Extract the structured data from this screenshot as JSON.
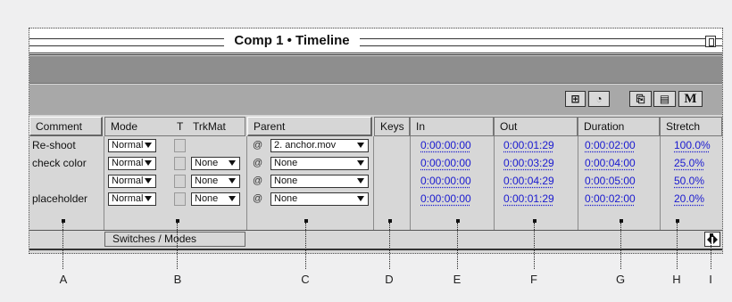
{
  "window": {
    "title": "Comp 1 • Timeline"
  },
  "toolbar": {
    "buttons": [
      "⊞",
      "◔",
      "⎘",
      "▤",
      "M"
    ]
  },
  "columns": {
    "comment": "Comment",
    "mode": "Mode",
    "t": "T",
    "trkmat": "TrkMat",
    "parent": "Parent",
    "keys": "Keys",
    "in": "In",
    "out": "Out",
    "duration": "Duration",
    "stretch": "Stretch"
  },
  "rows": [
    {
      "comment": "Re-shoot",
      "mode": "Normal",
      "trkmat": "",
      "parent": "2. anchor.mov",
      "in": "0:00:00:00",
      "out": "0:00:01:29",
      "duration": "0:00:02:00",
      "stretch": "100.0%"
    },
    {
      "comment": "check color",
      "mode": "Normal",
      "trkmat": "None",
      "parent": "None",
      "in": "0:00:00:00",
      "out": "0:00:03:29",
      "duration": "0:00:04:00",
      "stretch": "25.0%"
    },
    {
      "comment": "",
      "mode": "Normal",
      "trkmat": "None",
      "parent": "None",
      "in": "0:00:00:00",
      "out": "0:00:04:29",
      "duration": "0:00:05:00",
      "stretch": "50.0%"
    },
    {
      "comment": "placeholder",
      "mode": "Normal",
      "trkmat": "None",
      "parent": "None",
      "in": "0:00:00:00",
      "out": "0:00:01:29",
      "duration": "0:00:02:00",
      "stretch": "20.0%"
    }
  ],
  "footer": {
    "switches_modes": "Switches / Modes"
  },
  "callouts": [
    "A",
    "B",
    "C",
    "D",
    "E",
    "F",
    "G",
    "H",
    "I"
  ],
  "colors": {
    "time_link": "#1a1ad0",
    "dark_bar": "#8e8e8e",
    "toolbar": "#a8a8a8"
  }
}
